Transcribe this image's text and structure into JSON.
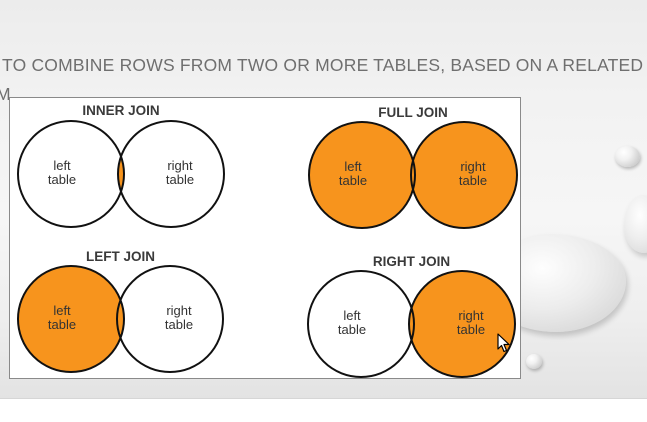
{
  "slide": {
    "title_line1": "TO COMBINE ROWS FROM TWO OR MORE TABLES, BASED ON A RELATED",
    "title_line2": "M"
  },
  "colors": {
    "fill": "#f7941d",
    "stroke": "#111111",
    "empty": "#ffffff",
    "title": "#6f6f6f"
  },
  "joins": [
    {
      "id": "inner",
      "title": "INNER JOIN",
      "left_label": "left\ntable",
      "right_label": "right\ntable",
      "left_filled": false,
      "right_filled": false,
      "overlap_filled": true
    },
    {
      "id": "full",
      "title": "FULL JOIN",
      "left_label": "left\ntable",
      "right_label": "right\ntable",
      "left_filled": true,
      "right_filled": true,
      "overlap_filled": true
    },
    {
      "id": "left",
      "title": "LEFT JOIN",
      "left_label": "left\ntable",
      "right_label": "right\ntable",
      "left_filled": true,
      "right_filled": false,
      "overlap_filled": true
    },
    {
      "id": "right",
      "title": "RIGHT JOIN",
      "left_label": "left\ntable",
      "right_label": "right\ntable",
      "left_filled": false,
      "right_filled": true,
      "overlap_filled": true
    }
  ],
  "icons": {
    "cursor": "mouse-pointer-icon"
  }
}
